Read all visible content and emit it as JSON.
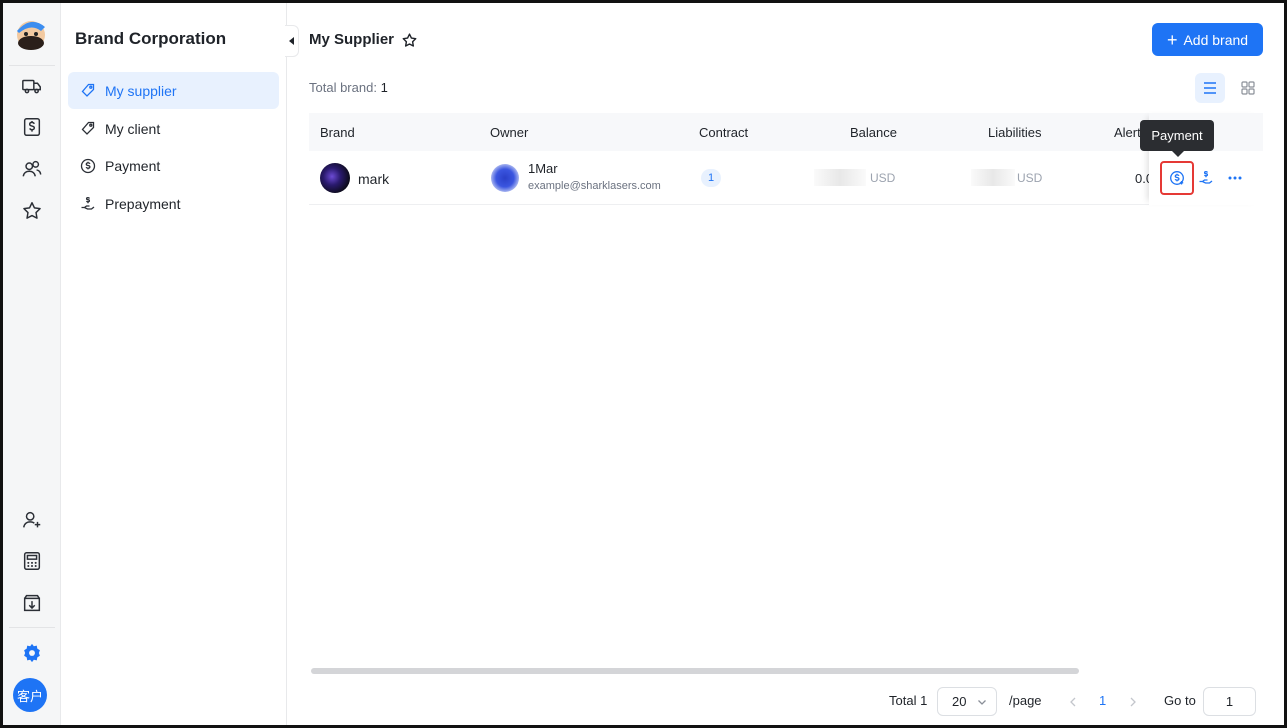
{
  "sidebar": {
    "rail_icons": [
      "truck-icon",
      "dollar-card-icon",
      "users-icon",
      "star-icon",
      "user-add-icon",
      "calculator-icon",
      "download-box-icon",
      "gear-icon"
    ],
    "avatar_text": "客户"
  },
  "subnav": {
    "title": "Brand Corporation",
    "items": [
      {
        "label": "My supplier",
        "icon": "tag-icon",
        "active": true
      },
      {
        "label": "My client",
        "icon": "tag-icon",
        "active": false
      },
      {
        "label": "Payment",
        "icon": "dollar-circle-icon",
        "active": false
      },
      {
        "label": "Prepayment",
        "icon": "hand-dollar-icon",
        "active": false
      }
    ]
  },
  "header": {
    "title": "My Supplier",
    "add_button": "Add brand",
    "total_label": "Total brand:",
    "total_value": "1"
  },
  "table": {
    "columns": [
      "Brand",
      "Owner",
      "Contract",
      "Balance",
      "Liabilities",
      "Alert"
    ],
    "rows": [
      {
        "brand": "mark",
        "owner_name": "1Mar",
        "owner_email": "example@sharklasers.com",
        "contract": "1",
        "balance_currency": "USD",
        "liabilities_currency": "USD",
        "alert": "0.0"
      }
    ]
  },
  "tooltip": "Payment",
  "pagination": {
    "total_label": "Total 1",
    "page_size": "20",
    "per_page": "/page",
    "current_page": "1",
    "goto_label": "Go to",
    "goto_value": "1"
  },
  "colors": {
    "accent": "#1e74f5",
    "highlight": "#e53935",
    "tooltip_bg": "#2b2d31"
  }
}
